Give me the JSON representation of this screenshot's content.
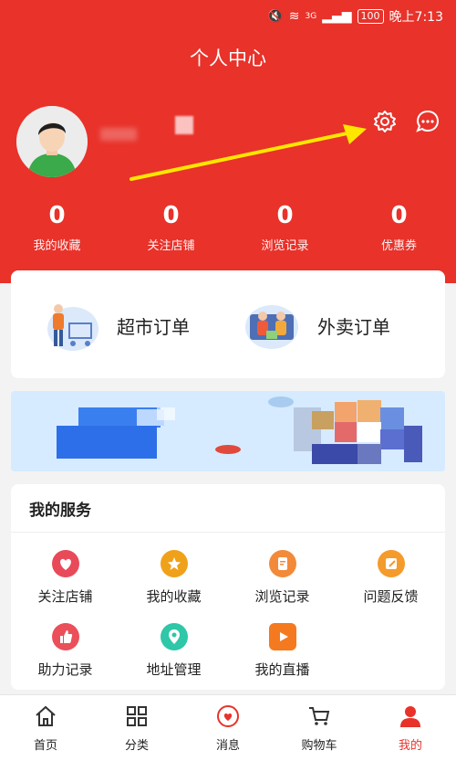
{
  "status_bar": {
    "battery": "100",
    "time": "晚上7:13",
    "network": "3G"
  },
  "header": {
    "title": "个人中心"
  },
  "stats": [
    {
      "value": "0",
      "label": "我的收藏"
    },
    {
      "value": "0",
      "label": "关注店铺"
    },
    {
      "value": "0",
      "label": "浏览记录"
    },
    {
      "value": "0",
      "label": "优惠券"
    }
  ],
  "orders": [
    {
      "label": "超市订单",
      "icon": "supermarket-illustration"
    },
    {
      "label": "外卖订单",
      "icon": "delivery-illustration"
    }
  ],
  "services": {
    "title": "我的服务",
    "items": [
      {
        "label": "关注店铺",
        "icon": "heart-icon",
        "color": "#e84a5a"
      },
      {
        "label": "我的收藏",
        "icon": "star-icon",
        "color": "#f0a11a"
      },
      {
        "label": "浏览记录",
        "icon": "document-icon",
        "color": "#f28a3a"
      },
      {
        "label": "问题反馈",
        "icon": "edit-icon",
        "color": "#f49b2b"
      },
      {
        "label": "助力记录",
        "icon": "thumb-up-icon",
        "color": "#ea4f5a"
      },
      {
        "label": "地址管理",
        "icon": "location-icon",
        "color": "#2ec7a8"
      },
      {
        "label": "我的直播",
        "icon": "play-icon",
        "color": "#f57a1f"
      }
    ]
  },
  "tabs": [
    {
      "label": "首页",
      "icon": "home-icon"
    },
    {
      "label": "分类",
      "icon": "grid-icon"
    },
    {
      "label": "消息",
      "icon": "message-heart-icon"
    },
    {
      "label": "购物车",
      "icon": "cart-icon"
    },
    {
      "label": "我的",
      "icon": "user-icon",
      "active": true
    }
  ],
  "colors": {
    "primary": "#e8322a",
    "annotation_arrow": "#ffe600"
  }
}
